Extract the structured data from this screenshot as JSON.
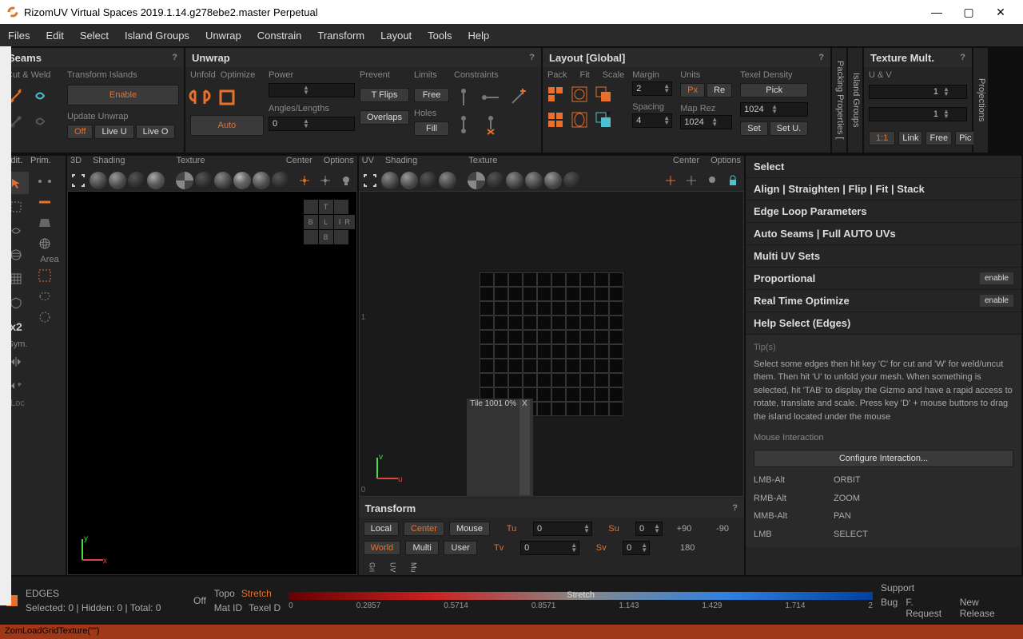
{
  "window": {
    "title": "RizomUV  Virtual Spaces 2019.1.14.g278ebe2.master Perpetual"
  },
  "menu": [
    "Files",
    "Edit",
    "Select",
    "Island Groups",
    "Unwrap",
    "Constrain",
    "Transform",
    "Layout",
    "Tools",
    "Help"
  ],
  "shelf": {
    "seams": {
      "title": "Seams",
      "cutweld": "Cut & Weld",
      "tislands": "Transform Islands",
      "enable": "Enable",
      "update": "Update Unwrap",
      "off": "Off",
      "liveu": "Live U",
      "liveo": "Live O"
    },
    "unwrap": {
      "title": "Unwrap",
      "unfold": "Unfold",
      "optimize": "Optimize",
      "auto": "Auto",
      "power": "Power",
      "angles": "Angles/Lengths",
      "angval": "0",
      "prevent": "Prevent",
      "tflips": "T Flips",
      "overlaps": "Overlaps",
      "limits": "Limits",
      "free": "Free",
      "holes": "Holes",
      "fill": "Fill",
      "constraints": "Constraints"
    },
    "layout": {
      "title": "Layout [Global]",
      "pack": "Pack",
      "fit": "Fit",
      "scale": "Scale",
      "margin": "Margin",
      "marginv": "2",
      "spacing": "Spacing",
      "spacingv": "4",
      "units": "Units",
      "px": "Px",
      "re": "Re",
      "maprez": "Map Rez",
      "maprezv": "1024",
      "td": "Texel Density",
      "pick": "Pick",
      "pickv": "1024",
      "set": "Set",
      "setu": "Set U."
    },
    "vtabs": {
      "pp": "Packing Properties [",
      "ig": "Island Groups",
      "proj": "Projections"
    },
    "texmult": {
      "title": "Texture Mult.",
      "uv": "U & V",
      "v1": "1",
      "v2": "1",
      "r11": "1:1",
      "link": "Link",
      "free": "Free",
      "pic": "Pic"
    }
  },
  "toolbar_left": {
    "edit": "Edit.",
    "prim": "Prim.",
    "area": "Area",
    "x2": "x2",
    "sym": "Sym.",
    "loc": "Loc"
  },
  "vp3d": {
    "labels": [
      "3D",
      "Shading",
      "Texture",
      "Center",
      "Options"
    ],
    "cube": {
      "t": "T",
      "b": "B",
      "l": "L",
      "f": "F",
      "r": "R",
      "b2": "B"
    },
    "axes": {
      "x": "x",
      "y": "y"
    }
  },
  "vpuv": {
    "labels": [
      "UV",
      "Shading",
      "Texture",
      "Center",
      "Options"
    ],
    "tile": "Tile 1001 0%",
    "tilex": "X",
    "axes": {
      "u": "u",
      "v": "v"
    },
    "vtabs": [
      "Gri",
      "UV",
      "Mu"
    ]
  },
  "right": {
    "select": "Select",
    "align": "Align | Straighten | Flip | Fit | Stack",
    "elp": "Edge Loop Parameters",
    "autoseams": "Auto Seams | Full AUTO UVs",
    "multiuv": "Multi UV Sets",
    "proportional": "Proportional",
    "enable": "enable",
    "rto": "Real Time Optimize",
    "helpsel": "Help Select (Edges)",
    "tips": "Tip(s)",
    "tiptext": "Select some edges then hit key 'C' for cut and 'W' for weld/uncut them. Then hit 'U' to unfold your mesh. When something is selected, hit 'TAB' to display the Gizmo and have a rapid access to rotate, translate and scale. Press key 'D' + mouse buttons to drag the island located under the mouse",
    "mouse": "Mouse Interaction",
    "config": "Configure Interaction...",
    "binds": [
      [
        "LMB-Alt",
        "ORBIT"
      ],
      [
        "RMB-Alt",
        "ZOOM"
      ],
      [
        "MMB-Alt",
        "PAN"
      ],
      [
        "LMB",
        "SELECT"
      ]
    ]
  },
  "transform": {
    "title": "Transform",
    "local": "Local",
    "center": "Center",
    "mouse": "Mouse",
    "world": "World",
    "multi": "Multi",
    "user": "User",
    "tu": "Tu",
    "tv": "Tv",
    "su": "Su",
    "sv": "Sv",
    "zero": "0",
    "p90": "+90",
    "m90": "-90",
    "r180": "180"
  },
  "status": {
    "mode": "EDGES",
    "sel": "Selected: 0 | Hidden: 0 | Total: 0",
    "off": "Off",
    "topo": "Topo",
    "stretch": "Stretch",
    "matid": "Mat ID",
    "texeld": "Texel D",
    "ticks": [
      "0",
      "0.2857",
      "0.5714",
      "0.8571",
      "1.143",
      "1.429",
      "1.714",
      "2"
    ],
    "barlabel": "Stretch",
    "support": "Support",
    "bug": "Bug",
    "freq": "F. Request",
    "newrel": "New Release"
  },
  "cmd": "ZomLoadGridTexture(\"\")"
}
